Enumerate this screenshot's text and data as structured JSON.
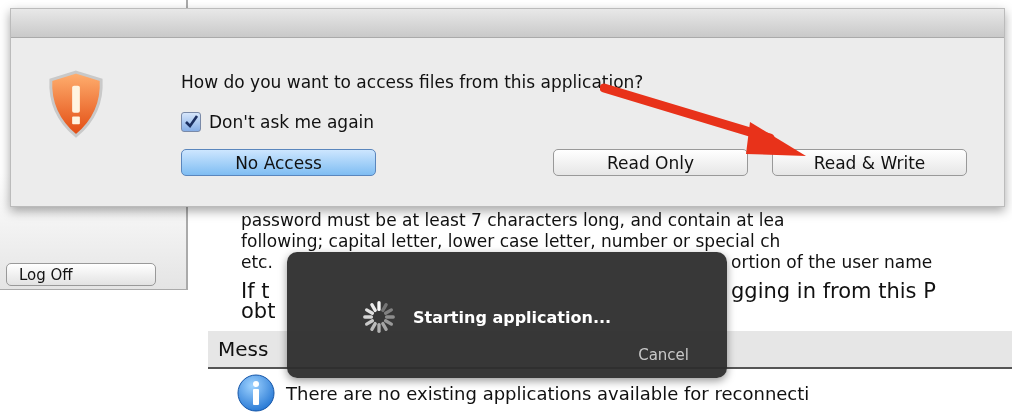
{
  "page": {
    "sidebar": {
      "logoff_button": "Log Off"
    },
    "paragraph_lines": [
      {
        "parts": [
          "password must be at least 7 characters long, and contain at lea"
        ]
      },
      {
        "parts": [
          "following; capital letter, lower case letter, number or special ch"
        ]
      },
      {
        "parts": [
          "etc.",
          "ortion of the user name"
        ]
      }
    ],
    "notice_lines": [
      {
        "parts": [
          "If t",
          "gging in from this P"
        ]
      },
      {
        "parts": [
          "obt"
        ]
      }
    ],
    "message_center": {
      "title": "Mess",
      "message": "There are no existing applications available for reconnecti"
    }
  },
  "dialog": {
    "question": "How do you want to access files from this application?",
    "dont_ask": {
      "label": "Don't ask me again",
      "checked": true
    },
    "buttons": [
      {
        "label": "No Access",
        "default": true
      },
      {
        "label": "Read Only",
        "default": false
      },
      {
        "label": "Read & Write",
        "default": false
      }
    ]
  },
  "progress_hud": {
    "message": "Starting application...",
    "cancel": "Cancel"
  }
}
